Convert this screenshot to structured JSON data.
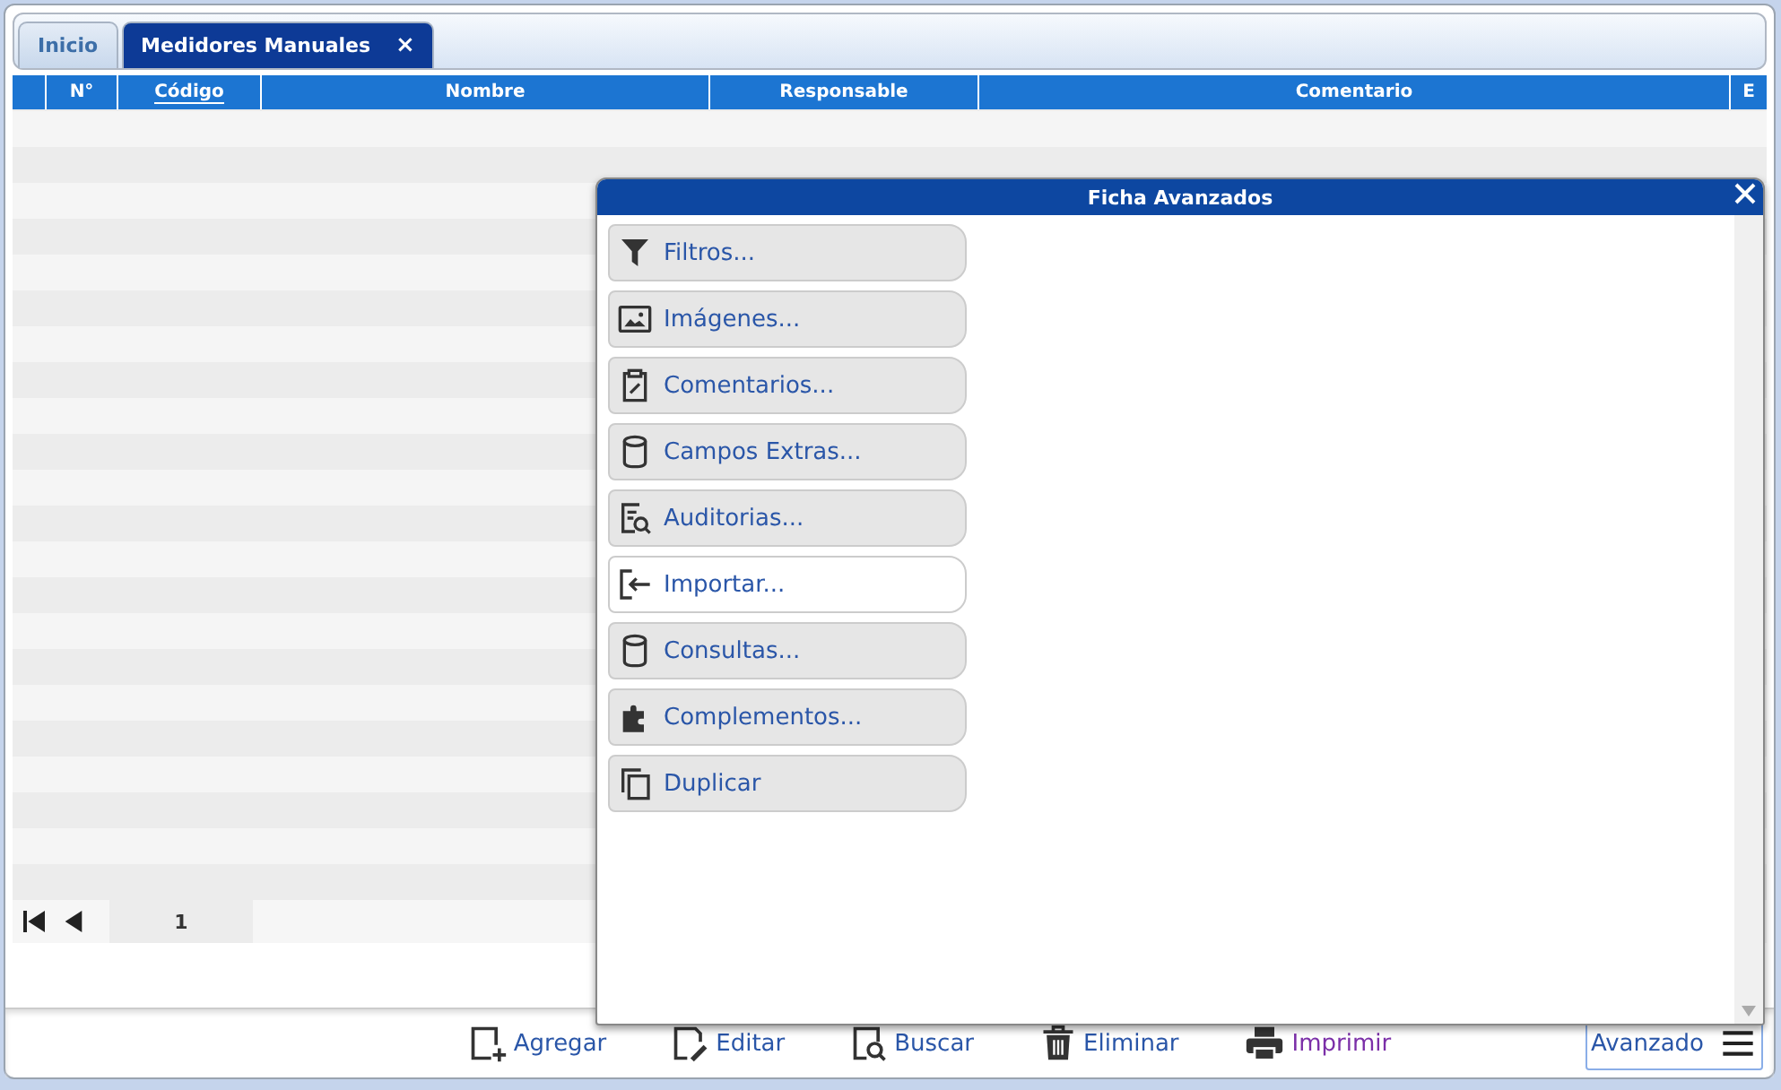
{
  "tabs": [
    {
      "label": "Inicio",
      "selected": false,
      "closable": false
    },
    {
      "label": "Medidores Manuales",
      "selected": true,
      "closable": true,
      "close_glyph": "×"
    }
  ],
  "table": {
    "columns": [
      {
        "sorted": false
      },
      {
        "label": "N°",
        "sorted": false
      },
      {
        "label": "Código",
        "sorted": true
      },
      {
        "label": "Nombre",
        "sorted": false
      },
      {
        "label": "Responsable",
        "sorted": false
      },
      {
        "label": "Comentario",
        "sorted": false
      },
      {
        "label": "E",
        "sorted": false
      }
    ]
  },
  "pager": {
    "page": "1"
  },
  "dialog": {
    "title": "Ficha Avanzados",
    "items": [
      {
        "kind": "filter",
        "label": "Filtros...",
        "selected": false
      },
      {
        "kind": "image",
        "label": "Imágenes...",
        "selected": false
      },
      {
        "kind": "clipboard",
        "label": "Comentarios...",
        "selected": false
      },
      {
        "kind": "database",
        "label": "Campos Extras...",
        "selected": false
      },
      {
        "kind": "audit",
        "label": "Auditorias...",
        "selected": false
      },
      {
        "kind": "import",
        "label": "Importar...",
        "selected": true
      },
      {
        "kind": "database",
        "label": "Consultas...",
        "selected": false
      },
      {
        "kind": "puzzle",
        "label": "Complementos...",
        "selected": false
      },
      {
        "kind": "copy",
        "label": "Duplicar",
        "selected": false
      }
    ]
  },
  "toolbar": {
    "buttons": [
      {
        "kind": "add",
        "label": "Agregar",
        "visited": false
      },
      {
        "kind": "edit",
        "label": "Editar",
        "visited": false
      },
      {
        "kind": "search",
        "label": "Buscar",
        "visited": false
      },
      {
        "kind": "delete",
        "label": "Eliminar",
        "visited": false
      },
      {
        "kind": "print",
        "label": "Imprimir",
        "visited": true
      }
    ],
    "advanced": {
      "label": "Avanzado"
    }
  }
}
